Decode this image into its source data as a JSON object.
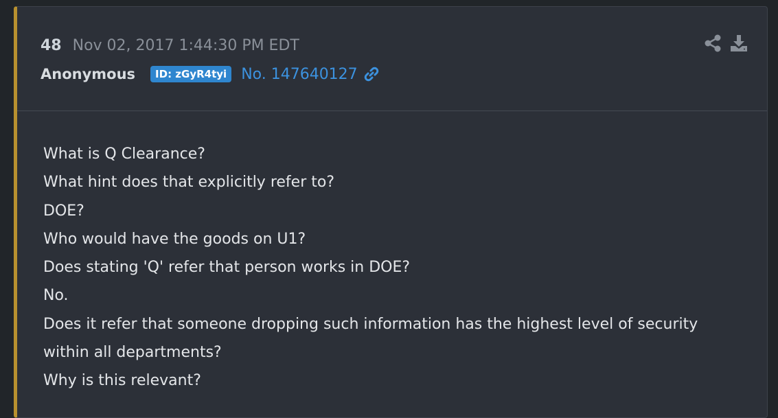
{
  "post": {
    "number": "48",
    "timestamp": "Nov 02, 2017 1:44:30 PM EDT",
    "author": "Anonymous",
    "id_badge": "ID: zGyR4tyi",
    "post_link": "No. 147640127",
    "link_icon": "link-icon",
    "share_icon": "share-icon",
    "download_icon": "download-icon",
    "body": "What is Q Clearance?\nWhat hint does that explicitly refer to?\nDOE?\nWho would have the goods on U1?\nDoes stating 'Q' refer that person works in DOE?\nNo.\nDoes it refer that someone dropping such information has the highest level of security\nwithin all departments?\nWhy is this relevant?"
  },
  "colors": {
    "accent_border": "#b8912f",
    "badge_bg": "#2f86cf",
    "link": "#3c92df",
    "card_bg": "#2c3038",
    "page_bg": "#212529"
  }
}
